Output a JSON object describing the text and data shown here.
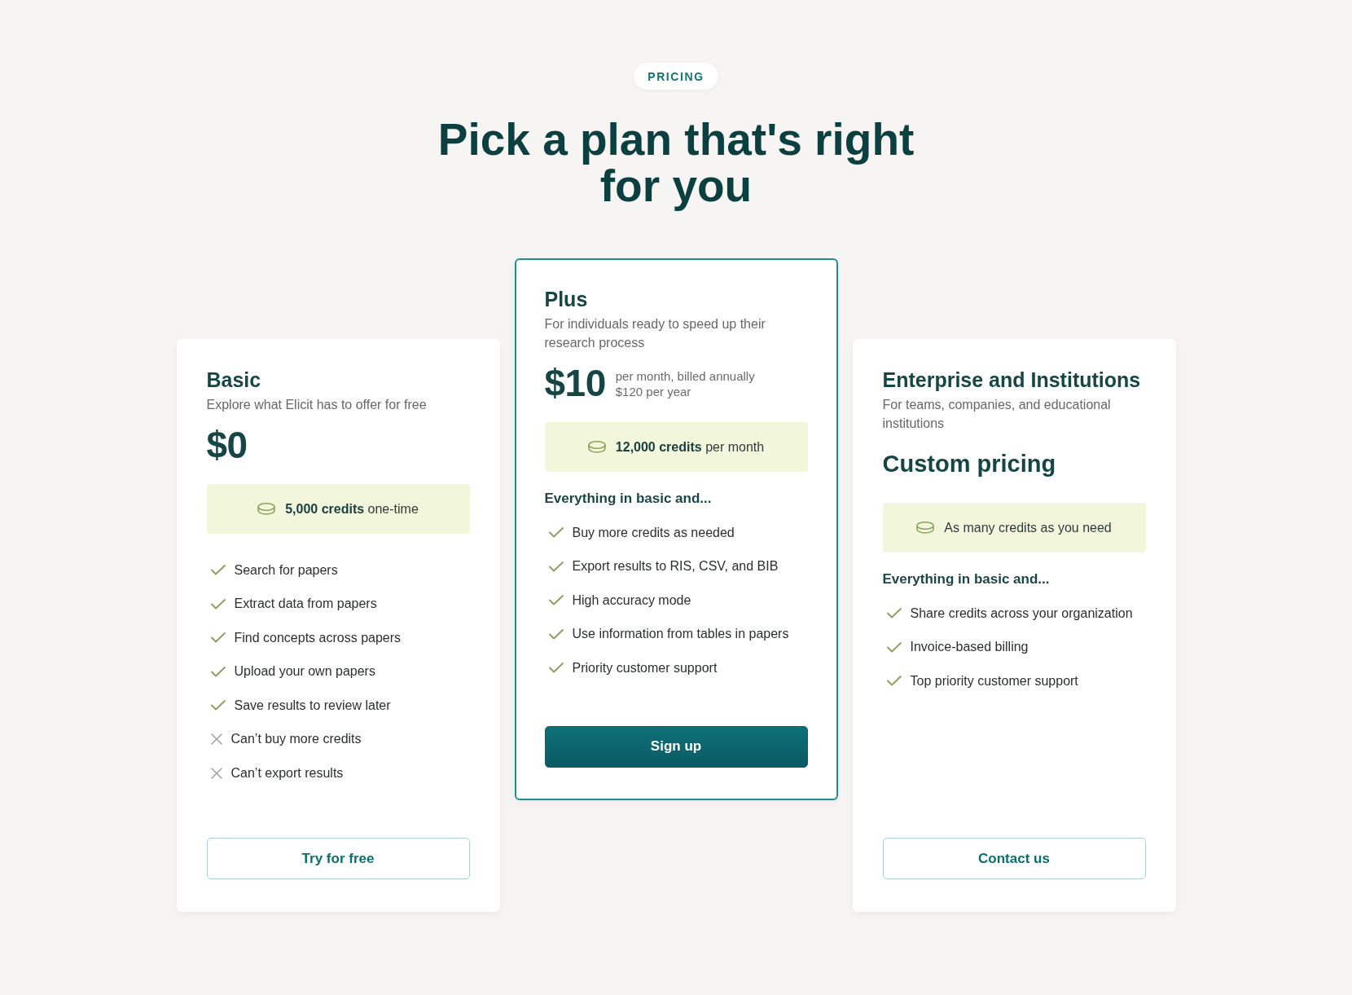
{
  "badge": "PRICING",
  "heading": "Pick a plan that's right for you",
  "plans": [
    {
      "name": "Basic",
      "description": "Explore what Elicit has to offer for free",
      "highlighted": false,
      "price": {
        "kind": "amount",
        "text": "$0"
      },
      "credits": "**5,000 credits** one-time",
      "features": [
        {
          "text": "Search for papers",
          "included": true
        },
        {
          "text": "Extract data from papers",
          "included": true
        },
        {
          "text": "Find concepts across papers",
          "included": true
        },
        {
          "text": "Upload your own papers",
          "included": true
        },
        {
          "text": "Save results to review later",
          "included": true
        },
        {
          "text": "Can’t buy more credits",
          "included": false
        },
        {
          "text": "Can’t export results",
          "included": false
        }
      ],
      "button": {
        "label": "Try for free",
        "kind": "outline"
      }
    },
    {
      "name": "Plus",
      "description": "For individuals ready to speed up their research process",
      "highlighted": true,
      "price": {
        "kind": "amount",
        "text": "$10",
        "notes": [
          "per month, billed annually",
          "$120 per year"
        ]
      },
      "credits": "**12,000 credits** per month",
      "features_heading": "Everything in basic and...",
      "features": [
        {
          "text": "Buy more credits as needed",
          "included": true
        },
        {
          "text": "Export results to RIS, CSV, and BIB",
          "included": true
        },
        {
          "text": "High accuracy mode",
          "included": true
        },
        {
          "text": "Use information from tables in papers",
          "included": true
        },
        {
          "text": "Priority customer support",
          "included": true
        }
      ],
      "button": {
        "label": "Sign up",
        "kind": "filled"
      }
    },
    {
      "name": "Enterprise and Institutions",
      "description": "For teams, companies, and educational institutions",
      "highlighted": false,
      "price": {
        "kind": "custom",
        "text": "Custom pricing"
      },
      "credits": "As many credits as you need",
      "features_heading": "Everything in basic and...",
      "features": [
        {
          "text": "Share credits across your organization",
          "included": true
        },
        {
          "text": "Invoice-based billing",
          "included": true
        },
        {
          "text": "Top priority customer support",
          "included": true
        }
      ],
      "button": {
        "label": "Contact us",
        "kind": "outline"
      }
    }
  ]
}
